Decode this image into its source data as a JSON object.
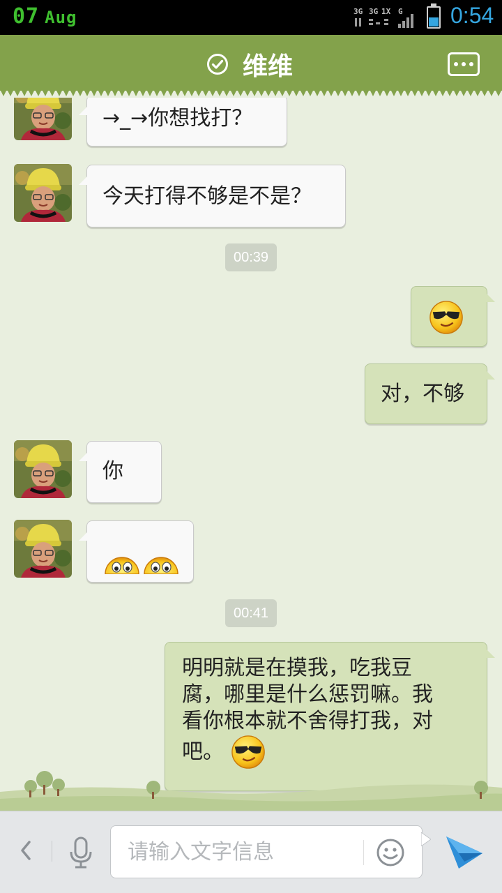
{
  "status_bar": {
    "date_day": "07",
    "date_month": "Aug",
    "network": "3G 3G 1X G",
    "battery_level": 0.45,
    "time": "0:54"
  },
  "header": {
    "title": "维维",
    "verified_icon": "check-circle-icon",
    "more_icon": "more-dots-icon"
  },
  "messages": [
    {
      "side": "in",
      "text": "→_→你想找打？"
    },
    {
      "side": "in",
      "text": "今天打得不够是不是？"
    },
    {
      "type": "time",
      "text": "00:39"
    },
    {
      "side": "out",
      "emoji": "cool-face-emoji"
    },
    {
      "side": "out",
      "text": "对，不够"
    },
    {
      "side": "in",
      "text": "你"
    },
    {
      "side": "in",
      "emoji": "peeking-eyes-emoji"
    },
    {
      "type": "time",
      "text": "00:41"
    },
    {
      "side": "out",
      "text_lines": [
        "明明就是在摸我，吃我豆",
        "腐，哪里是什么惩罚嘛。我",
        "看你根本就不舍得打我，对",
        "吧。"
      ],
      "emoji": "cool-face-emoji"
    }
  ],
  "input_bar": {
    "placeholder": "请输入文字信息",
    "back_icon": "chevron-left-icon",
    "mic_icon": "microphone-icon",
    "emoji_icon": "smiley-icon",
    "send_icon": "send-icon"
  },
  "colors": {
    "header_green": "#83a24b",
    "chat_bg": "#e9efdf",
    "outgoing_bubble": "#d5e2b9",
    "incoming_bubble": "#f9f9f9",
    "accent_blue": "#35a6e0"
  }
}
